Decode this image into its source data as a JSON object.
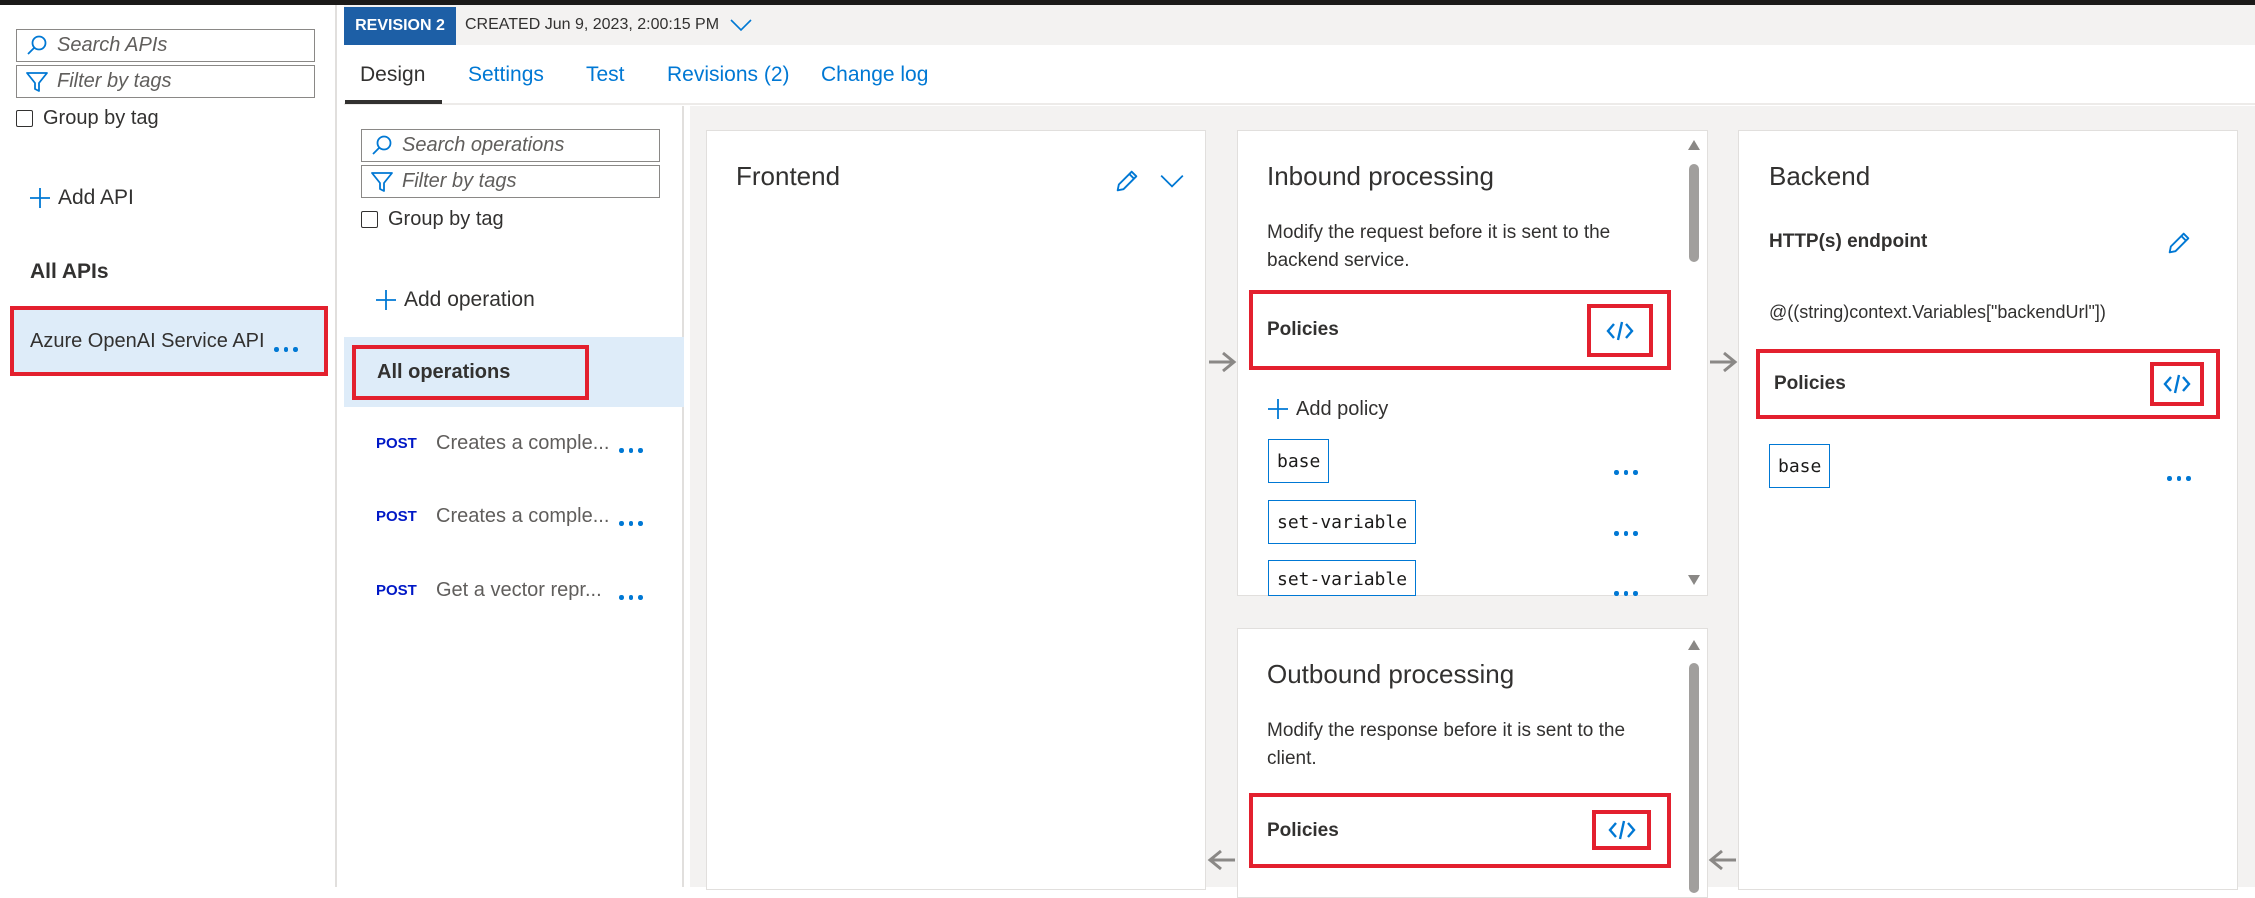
{
  "left_panel": {
    "search_placeholder": "Search APIs",
    "filter_placeholder": "Filter by tags",
    "group_by_tag": "Group by tag",
    "add_api": "Add API",
    "all_apis_title": "All APIs",
    "api_item": "Azure OpenAI Service API"
  },
  "header": {
    "revision_badge": "REVISION 2",
    "created": "CREATED Jun 9, 2023, 2:00:15 PM"
  },
  "tabs": [
    {
      "label": "Design",
      "active": true
    },
    {
      "label": "Settings"
    },
    {
      "label": "Test"
    },
    {
      "label": "Revisions (2)"
    },
    {
      "label": "Change log"
    }
  ],
  "operations": {
    "search_placeholder": "Search operations",
    "filter_placeholder": "Filter by tags",
    "group_by_tag": "Group by tag",
    "add_operation": "Add operation",
    "all_operations": "All operations",
    "items": [
      {
        "method": "POST",
        "name": "Creates a comple..."
      },
      {
        "method": "POST",
        "name": "Creates a comple..."
      },
      {
        "method": "POST",
        "name": "Get a vector repr..."
      }
    ]
  },
  "frontend": {
    "title": "Frontend"
  },
  "inbound": {
    "title": "Inbound processing",
    "description_line1": "Modify the request before it is sent to the",
    "description_line2": "backend service.",
    "policies_label": "Policies",
    "add_policy": "Add policy",
    "chips": [
      "base",
      "set-variable",
      "set-variable"
    ]
  },
  "outbound": {
    "title": "Outbound processing",
    "description_line1": "Modify the response before it is sent to the",
    "description_line2": "client.",
    "policies_label": "Policies"
  },
  "backend": {
    "title": "Backend",
    "endpoint_label": "HTTP(s) endpoint",
    "endpoint_value": "@((string)context.Variables[\"backendUrl\"])",
    "policies_label": "Policies",
    "chip": "base"
  },
  "colors": {
    "accent": "#0078d4",
    "highlight_red": "#e3202e",
    "selected_bg": "#deecf9",
    "revision_badge": "#1d5fa6"
  }
}
